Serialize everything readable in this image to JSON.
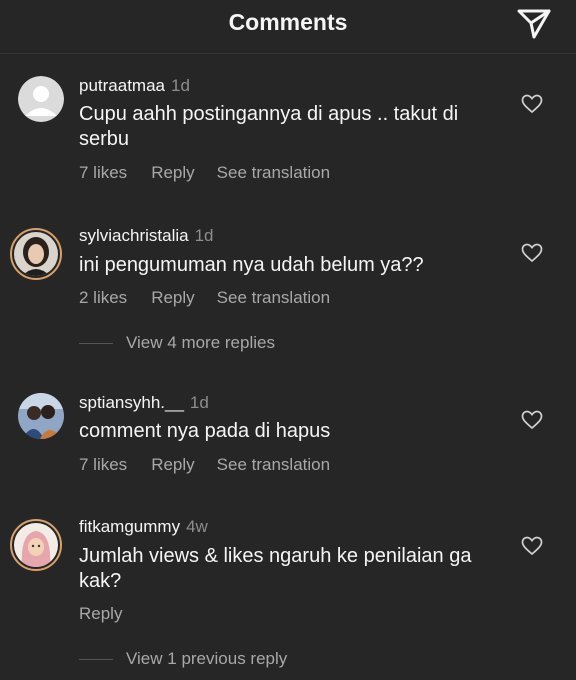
{
  "header": {
    "title": "Comments",
    "share_icon": "send-icon"
  },
  "comments": [
    {
      "username": "putraatmaa",
      "time": "1d",
      "text": "Cupu aahh postingannya di apus .. takut di serbu",
      "likes": "7 likes",
      "reply": "Reply",
      "translate": "See translation"
    },
    {
      "username": "sylviachristalia",
      "time": "1d",
      "text": "ini pengumuman nya udah belum ya??",
      "likes": "2 likes",
      "reply": "Reply",
      "translate": "See translation",
      "view_replies": "View 4 more replies"
    },
    {
      "username": "sptiansyhh.__",
      "time": "1d",
      "text": "comment nya pada di hapus",
      "likes": "7 likes",
      "reply": "Reply",
      "translate": "See translation"
    },
    {
      "username": "fitkamgummy",
      "time": "4w",
      "text": "Jumlah views & likes ngaruh ke penilaian ga kak?",
      "reply": "Reply",
      "view_replies": "View 1 previous reply"
    }
  ],
  "colors": {
    "background": "#262626",
    "text": "#f5f5f5",
    "muted": "#a8a8a8",
    "story_ring": "#d8a06a"
  }
}
